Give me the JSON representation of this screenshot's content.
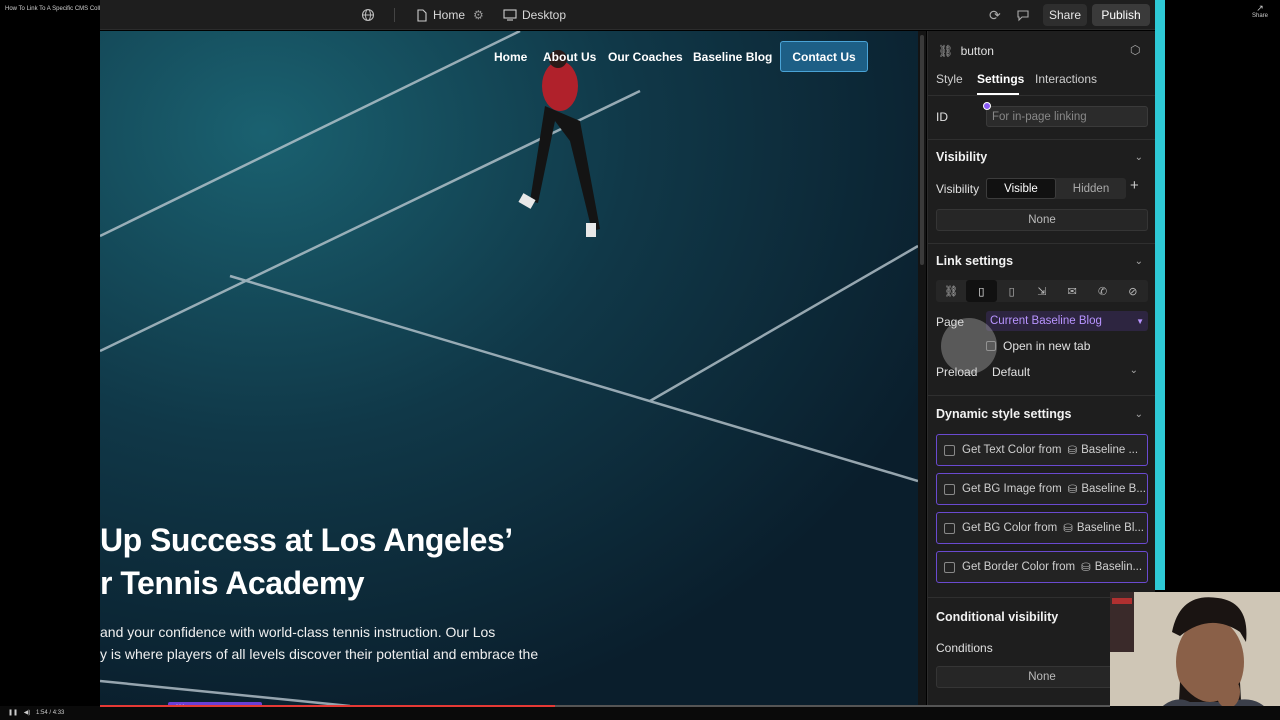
{
  "video": {
    "title": "How To Link To A Specific CMS Collection Page In Webflow",
    "share_label": "Share",
    "time": "1:54 / 4:33"
  },
  "topbar": {
    "page_name": "Home",
    "breakpoint": "Desktop",
    "share_label": "Share",
    "publish_label": "Publish"
  },
  "site": {
    "nav": [
      "Home",
      "About Us",
      "Our Coaches",
      "Baseline Blog"
    ],
    "cta": "Contact Us",
    "hero_line1": "Up Success at Los Angeles’",
    "hero_line2": "r Tennis Academy",
    "body_line1": "and your confidence with world-class tennis instruction. Our Los",
    "body_line2": "y is where players of all levels discover their potential and embrace the"
  },
  "selection": {
    "label": "button"
  },
  "panel": {
    "element_name": "button",
    "tabs": [
      "Style",
      "Settings",
      "Interactions"
    ],
    "active_tab": "Settings",
    "id_label": "ID",
    "id_placeholder": "For in-page linking",
    "visibility": {
      "title": "Visibility",
      "label": "Visibility",
      "options": [
        "Visible",
        "Hidden"
      ],
      "selected": "Visible",
      "none": "None"
    },
    "link": {
      "title": "Link settings",
      "page_label": "Page",
      "page_value": "Current Baseline Blog",
      "new_tab_label": "Open in new tab",
      "preload_label": "Preload",
      "preload_value": "Default"
    },
    "dynamic": {
      "title": "Dynamic style settings",
      "items": [
        {
          "text": "Get Text Color from",
          "source": "Baseline ..."
        },
        {
          "text": "Get BG Image from",
          "source": "Baseline B..."
        },
        {
          "text": "Get BG Color from",
          "source": "Baseline Bl..."
        },
        {
          "text": "Get Border Color from",
          "source": "Baselin..."
        }
      ]
    },
    "conditional": {
      "title": "Conditional visibility",
      "conditions_label": "Conditions",
      "none": "None"
    }
  },
  "colors": {
    "accent_purple": "#6b3fd6",
    "cta_blue": "#1d5f86",
    "court": "#0e2a38"
  }
}
